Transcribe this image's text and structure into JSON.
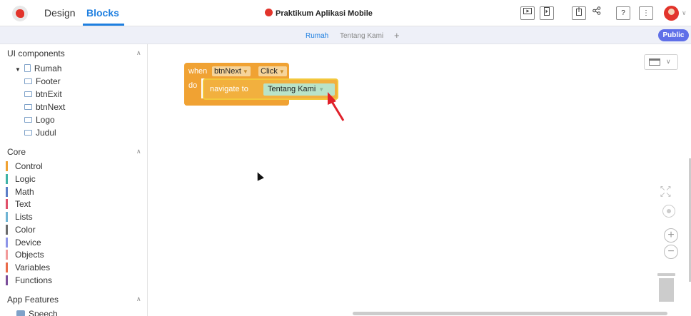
{
  "header": {
    "tabs": {
      "design": "Design",
      "blocks": "Blocks"
    },
    "project_title": "Praktikum Aplikasi Mobile",
    "icons": [
      "preview-icon",
      "device-icon",
      "export-icon",
      "share-icon",
      "help-icon",
      "more-icon"
    ],
    "help_label": "?",
    "more_label": "⋮"
  },
  "screens": {
    "tabs": [
      "Rumah",
      "Tentang Kami"
    ],
    "add": "+",
    "public_label": "Public"
  },
  "left_panel": {
    "ui_components_title": "UI components",
    "components": [
      {
        "label": "Rumah",
        "icon": "screen-icon"
      },
      {
        "label": "Footer",
        "icon": "label-icon"
      },
      {
        "label": "btnExit",
        "icon": "button-icon"
      },
      {
        "label": "btnNext",
        "icon": "button-icon"
      },
      {
        "label": "Logo",
        "icon": "image-icon"
      },
      {
        "label": "Judul",
        "icon": "label-icon"
      }
    ],
    "core_title": "Core",
    "core_items": [
      {
        "label": "Control",
        "color": "#f0a233"
      },
      {
        "label": "Logic",
        "color": "#3fb3a6"
      },
      {
        "label": "Math",
        "color": "#5c7ec7"
      },
      {
        "label": "Text",
        "color": "#e0506a"
      },
      {
        "label": "Lists",
        "color": "#6fb4d4"
      },
      {
        "label": "Color",
        "color": "#6b6b6b"
      },
      {
        "label": "Device",
        "color": "#8e95e8"
      },
      {
        "label": "Objects",
        "color": "#f29a9a"
      },
      {
        "label": "Variables",
        "color": "#ea6b4a"
      },
      {
        "label": "Functions",
        "color": "#7b4e9a"
      }
    ],
    "app_features_title": "App Features",
    "app_features_items": [
      {
        "label": "Speech"
      }
    ]
  },
  "blocks": {
    "when_label": "when",
    "component": "btnNext",
    "event": "Click",
    "do_label": "do",
    "navigate_label": "navigate to",
    "target": "Tentang Kami"
  },
  "colors": {
    "accent": "#1e7fe0",
    "public_button": "#5f6fe8",
    "event_block": "#f0a233",
    "text_block": "#b9e3c8",
    "arrow": "#e0202a"
  }
}
